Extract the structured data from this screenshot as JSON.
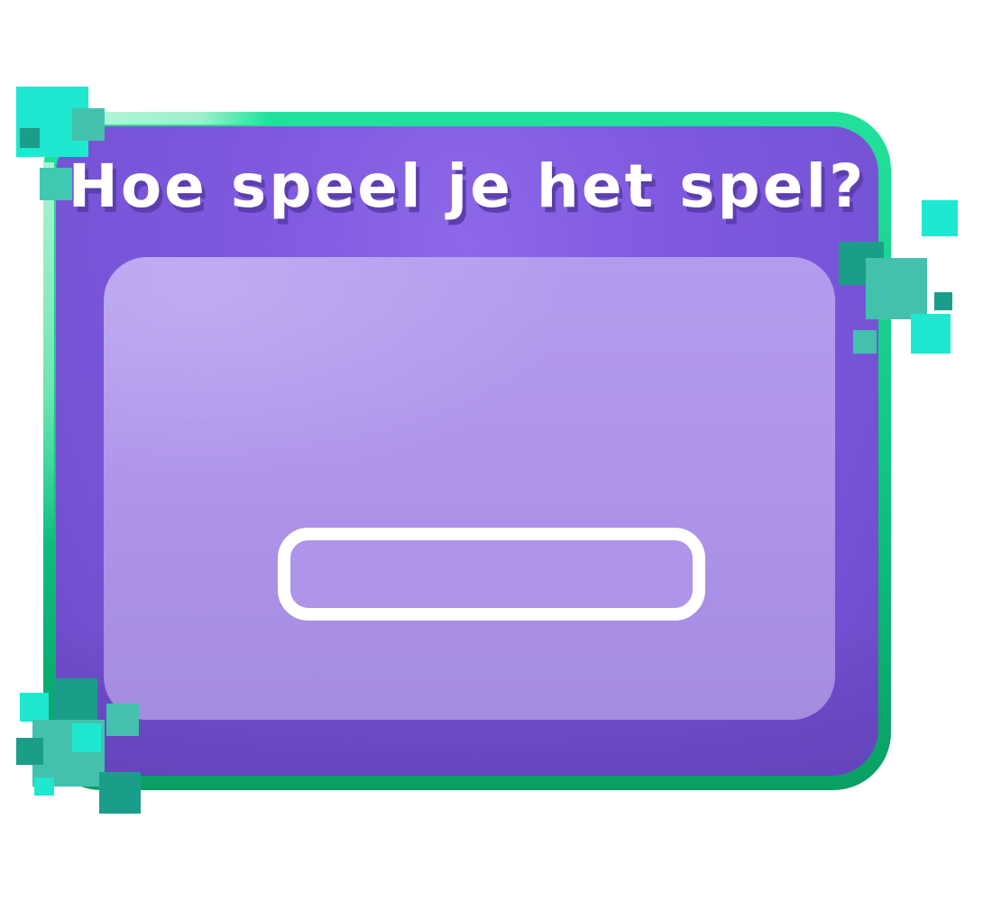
{
  "dialog": {
    "title": "Hoe speel je het spel?",
    "button_label": ""
  },
  "colors": {
    "frame": "#0fc483",
    "panel": "#7f59df",
    "content": "#ae94eb",
    "title_text": "#ffffff",
    "title_shadow": "#5b3fae",
    "pixel_light": "#1ee8cf",
    "pixel_mid": "#44c1ad",
    "pixel_dark": "#1a9e8a"
  }
}
